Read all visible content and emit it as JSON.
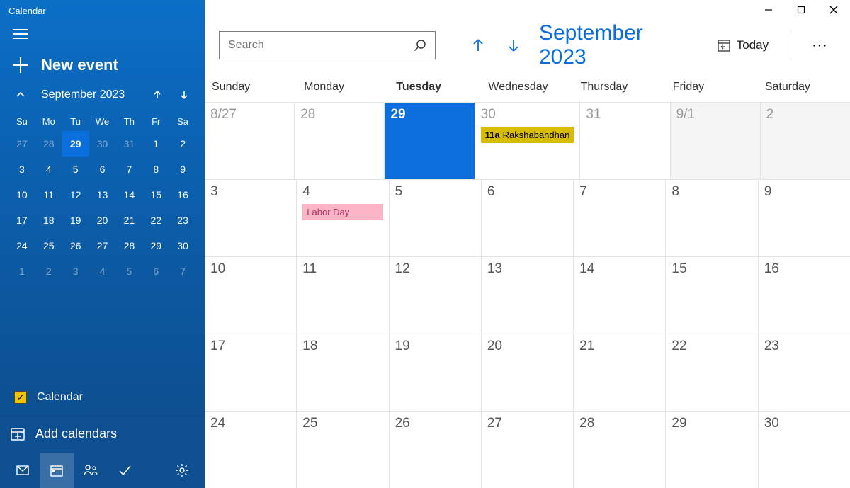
{
  "app_title": "Calendar",
  "new_event_label": "New event",
  "mini": {
    "title": "September 2023",
    "dow": [
      "Su",
      "Mo",
      "Tu",
      "We",
      "Th",
      "Fr",
      "Sa"
    ],
    "rows": [
      [
        {
          "n": "27",
          "dim": true
        },
        {
          "n": "28",
          "dim": true
        },
        {
          "n": "29",
          "today": true
        },
        {
          "n": "30",
          "dim": true
        },
        {
          "n": "31",
          "dim": true
        },
        {
          "n": "1"
        },
        {
          "n": "2"
        }
      ],
      [
        {
          "n": "3"
        },
        {
          "n": "4"
        },
        {
          "n": "5"
        },
        {
          "n": "6"
        },
        {
          "n": "7"
        },
        {
          "n": "8"
        },
        {
          "n": "9"
        }
      ],
      [
        {
          "n": "10"
        },
        {
          "n": "11"
        },
        {
          "n": "12"
        },
        {
          "n": "13"
        },
        {
          "n": "14"
        },
        {
          "n": "15"
        },
        {
          "n": "16"
        }
      ],
      [
        {
          "n": "17"
        },
        {
          "n": "18"
        },
        {
          "n": "19"
        },
        {
          "n": "20"
        },
        {
          "n": "21"
        },
        {
          "n": "22"
        },
        {
          "n": "23"
        }
      ],
      [
        {
          "n": "24"
        },
        {
          "n": "25"
        },
        {
          "n": "26"
        },
        {
          "n": "27"
        },
        {
          "n": "28"
        },
        {
          "n": "29"
        },
        {
          "n": "30"
        }
      ],
      [
        {
          "n": "1",
          "dim": true
        },
        {
          "n": "2",
          "dim": true
        },
        {
          "n": "3",
          "dim": true
        },
        {
          "n": "4",
          "dim": true
        },
        {
          "n": "5",
          "dim": true
        },
        {
          "n": "6",
          "dim": true
        },
        {
          "n": "7",
          "dim": true
        }
      ]
    ]
  },
  "calendars": [
    {
      "name": "Calendar",
      "checked": true
    }
  ],
  "add_calendars_label": "Add calendars",
  "search_placeholder": "Search",
  "month_label": "September 2023",
  "today_label": "Today",
  "dow_full": [
    "Sunday",
    "Monday",
    "Tuesday",
    "Wednesday",
    "Thursday",
    "Friday",
    "Saturday"
  ],
  "today_dow_index": 2,
  "weeks": [
    [
      {
        "label": "8/27",
        "dim": true
      },
      {
        "label": "28",
        "dim": true
      },
      {
        "label": "29",
        "today": true
      },
      {
        "label": "30",
        "dim": true,
        "events": [
          {
            "kind": "yellow",
            "time": "11a",
            "title": "Rakshabandhan"
          }
        ]
      },
      {
        "label": "31",
        "dim": true
      },
      {
        "label": "9/1",
        "nextmonth": true
      },
      {
        "label": "2",
        "nextmonth": true
      }
    ],
    [
      {
        "label": "3"
      },
      {
        "label": "4",
        "events": [
          {
            "kind": "pink",
            "title": "Labor Day"
          }
        ]
      },
      {
        "label": "5"
      },
      {
        "label": "6"
      },
      {
        "label": "7"
      },
      {
        "label": "8"
      },
      {
        "label": "9"
      }
    ],
    [
      {
        "label": "10"
      },
      {
        "label": "11"
      },
      {
        "label": "12"
      },
      {
        "label": "13"
      },
      {
        "label": "14"
      },
      {
        "label": "15"
      },
      {
        "label": "16"
      }
    ],
    [
      {
        "label": "17"
      },
      {
        "label": "18"
      },
      {
        "label": "19"
      },
      {
        "label": "20"
      },
      {
        "label": "21"
      },
      {
        "label": "22"
      },
      {
        "label": "23"
      }
    ],
    [
      {
        "label": "24"
      },
      {
        "label": "25"
      },
      {
        "label": "26"
      },
      {
        "label": "27"
      },
      {
        "label": "28"
      },
      {
        "label": "29"
      },
      {
        "label": "30"
      }
    ]
  ]
}
